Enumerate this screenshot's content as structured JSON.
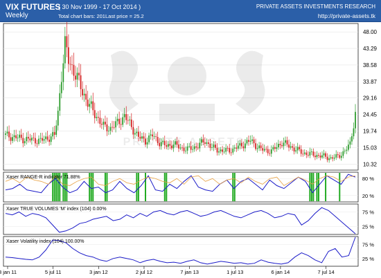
{
  "header": {
    "title": "VIX FUTURES",
    "subtitle": "Weekly",
    "date_range": "( 30 Nov 1999 - 17 Oct 2014 )",
    "total_bars": "Total chart bars: 201",
    "last_price": "Last price = 25.2",
    "firm": "PRIVATE ASSETS INVESTMENTS RESEARCH",
    "url": "http://private-assets.tk"
  },
  "watermark": "PRIVATE ASSETS",
  "colors": {
    "header_bg": "#2b5fa8",
    "bull": "#2a9a2a",
    "bear": "#d42020",
    "indicator_line": "#1a1ac8",
    "range_orange": "#e8a040",
    "range_bars": "#22aa22"
  },
  "chart_data": [
    {
      "type": "candlestick",
      "title": "VIX FUTURES",
      "ylim": [
        9.0,
        50.0
      ],
      "y_ticks": [
        "48.00",
        "43.29",
        "38.58",
        "33.87",
        "29.16",
        "24.45",
        "19.74",
        "15.03",
        "10.32"
      ],
      "y_tick_values": [
        48.0,
        43.29,
        38.58,
        33.87,
        29.16,
        24.45,
        19.74,
        15.03,
        10.32
      ],
      "x_ticks": [
        "3 jan 11",
        "5 jul 11",
        "3 jan 12",
        "2 jul 12",
        "7 jan 13",
        "1 jul 13",
        "6 jan 14",
        "7 jul 14"
      ],
      "bars": 201,
      "last": 25.2,
      "anchors": [
        [
          0,
          18.5
        ],
        [
          10,
          17.5
        ],
        [
          20,
          17.0
        ],
        [
          28,
          18.5
        ],
        [
          30,
          25.0
        ],
        [
          32,
          36.0
        ],
        [
          34,
          44.0
        ],
        [
          36,
          40.0
        ],
        [
          40,
          36.0
        ],
        [
          44,
          31.0
        ],
        [
          48,
          27.0
        ],
        [
          52,
          24.0
        ],
        [
          56,
          21.0
        ],
        [
          60,
          20.5
        ],
        [
          64,
          22.0
        ],
        [
          68,
          24.0
        ],
        [
          72,
          21.0
        ],
        [
          76,
          18.0
        ],
        [
          80,
          17.0
        ],
        [
          84,
          18.5
        ],
        [
          88,
          16.5
        ],
        [
          92,
          15.5
        ],
        [
          96,
          16.0
        ],
        [
          100,
          15.0
        ],
        [
          104,
          14.5
        ],
        [
          110,
          15.5
        ],
        [
          114,
          17.0
        ],
        [
          118,
          15.0
        ],
        [
          124,
          14.0
        ],
        [
          130,
          14.5
        ],
        [
          136,
          16.0
        ],
        [
          140,
          17.0
        ],
        [
          146,
          14.5
        ],
        [
          152,
          14.0
        ],
        [
          158,
          16.5
        ],
        [
          164,
          15.0
        ],
        [
          170,
          13.5
        ],
        [
          176,
          13.0
        ],
        [
          182,
          12.5
        ],
        [
          186,
          12.0
        ],
        [
          190,
          12.5
        ],
        [
          194,
          14.0
        ],
        [
          197,
          16.0
        ],
        [
          199,
          22.0
        ],
        [
          200,
          25.2
        ]
      ]
    },
    {
      "type": "line",
      "title": "Xaser RANGE-R indicator  71.88%",
      "y_ticks": [
        "80 %",
        "20 %"
      ],
      "ylim": [
        0,
        100
      ],
      "series": [
        {
          "values": [
            40,
            45,
            60,
            40,
            35,
            30,
            60,
            80,
            50,
            30,
            40,
            70,
            45,
            50,
            30,
            40,
            70,
            45,
            30,
            55,
            90,
            40,
            35,
            60,
            45,
            70,
            90,
            50,
            40,
            35,
            60,
            75,
            45,
            70,
            80,
            60,
            40,
            75,
            55,
            45,
            65,
            85,
            70,
            30,
            60,
            90,
            75,
            60,
            95,
            85
          ]
        },
        {
          "values": [
            70,
            80,
            65,
            85,
            75,
            70,
            60,
            90,
            60,
            55,
            70,
            80,
            85,
            60,
            55,
            70,
            80,
            65,
            60,
            75,
            85,
            80,
            70,
            65,
            80,
            60,
            85,
            90,
            70,
            80,
            60,
            75,
            80,
            65,
            85,
            70,
            60,
            80,
            85,
            55,
            70,
            85,
            75,
            60,
            80,
            90,
            85,
            70,
            85,
            90
          ]
        }
      ],
      "highlight_bars": [
        27,
        28,
        29,
        30,
        31,
        33,
        34,
        35,
        48,
        49,
        50,
        57,
        58,
        75,
        76,
        80,
        91,
        92,
        130,
        131,
        174,
        175,
        176,
        178,
        179,
        183,
        191
      ]
    },
    {
      "type": "line",
      "title": "Xaser TRUE VOLUMES 'M' index (104)  0.00%",
      "y_ticks": [
        "75 %",
        "25 %"
      ],
      "ylim": [
        0,
        100
      ],
      "series": [
        {
          "values": [
            70,
            65,
            75,
            60,
            70,
            65,
            55,
            30,
            5,
            10,
            20,
            35,
            40,
            50,
            55,
            60,
            45,
            50,
            65,
            55,
            70,
            60,
            75,
            80,
            70,
            65,
            75,
            80,
            70,
            60,
            65,
            75,
            80,
            70,
            60,
            55,
            65,
            75,
            80,
            70,
            55,
            60,
            70,
            65,
            30,
            45,
            70,
            90,
            80,
            60,
            40,
            20,
            0
          ]
        }
      ]
    },
    {
      "type": "line",
      "title": "Xaser Volatility index (104)  100.00%",
      "y_ticks": [
        "75 %",
        "25 %"
      ],
      "ylim": [
        0,
        100
      ],
      "series": [
        {
          "values": [
            30,
            28,
            25,
            22,
            20,
            30,
            55,
            90,
            88,
            80,
            60,
            45,
            35,
            30,
            20,
            15,
            25,
            30,
            25,
            20,
            10,
            18,
            22,
            15,
            10,
            12,
            8,
            15,
            20,
            10,
            5,
            10,
            15,
            12,
            8,
            10,
            5,
            8,
            20,
            12,
            8,
            5,
            10,
            30,
            45,
            35,
            20,
            10,
            50,
            60,
            30,
            35,
            100
          ]
        }
      ]
    }
  ]
}
